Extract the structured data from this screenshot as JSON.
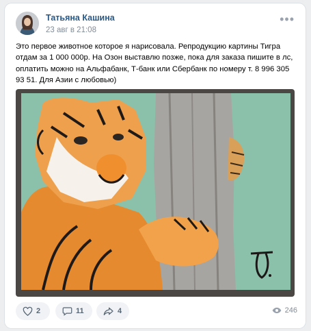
{
  "post": {
    "author": "Татьяна Кашина",
    "date": "23 авг в 21:08",
    "more_icon": "more-horizontal-icon",
    "text": "Это первое животное которое я нарисовала. Репродукцию картины Тигра отдам за 1 000 000р. На Озон выставлю позже, пока для заказа пишите в лс, оплатить можно на Альфабанк, Т-банк или Сбербанк по номеру т. 8 996 305 93 51. Для Азии с любовью)",
    "image_signature": "J."
  },
  "actions": {
    "likes": "2",
    "comments": "11",
    "shares": "4",
    "views": "246"
  },
  "colors": {
    "author": "#2a5885",
    "meta": "#818c99",
    "pill_bg": "#f0f2f5",
    "painting_bg": "#7fb8a2",
    "tree": "#9b9a97",
    "tiger": "#e58a2e"
  }
}
